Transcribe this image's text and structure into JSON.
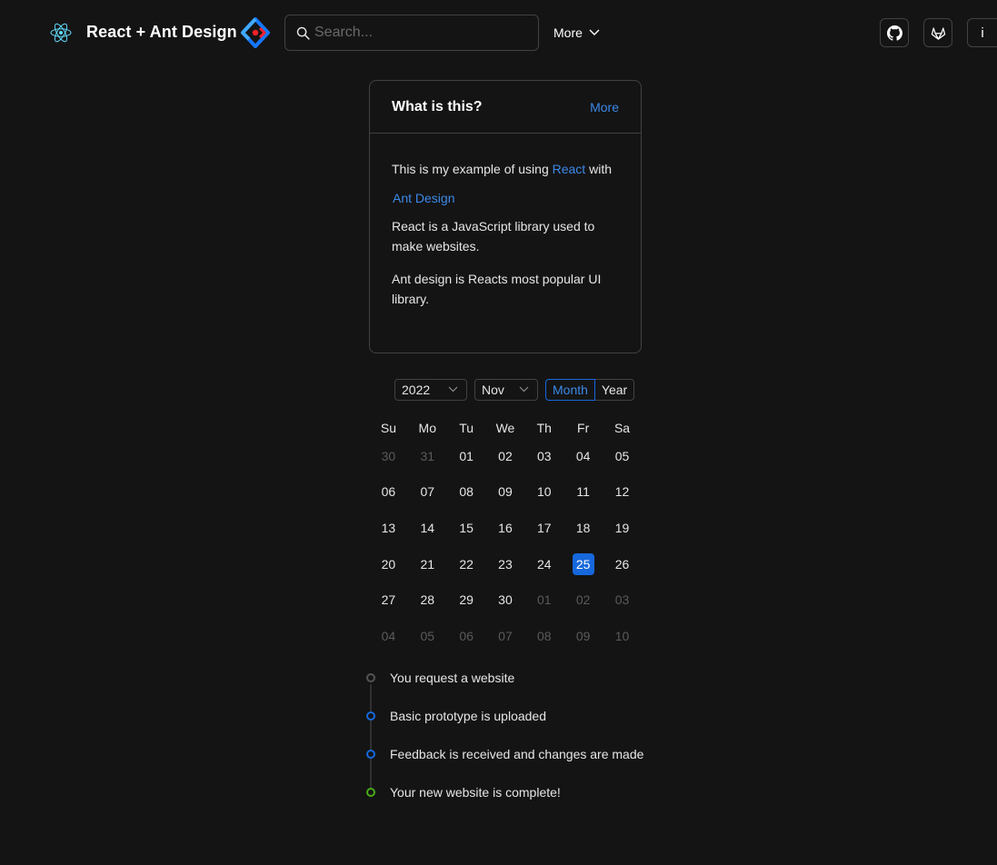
{
  "header": {
    "brand": "React + Ant Design",
    "search_placeholder": "Search...",
    "more_label": "More",
    "icons": [
      "react-logo-icon",
      "ant-design-logo-icon",
      "search-icon",
      "chevron-down-icon",
      "github-icon",
      "gitlab-icon",
      "info-icon"
    ],
    "info_label": "i"
  },
  "card": {
    "title": "What is this?",
    "extra": "More",
    "intro_prefix": "This is my example of using",
    "react_link": "React",
    "intro_middle": "with",
    "antd_link": "Ant Design",
    "paragraph2": "React is a JavaScript library used to make websites.",
    "paragraph3": "Ant design is Reacts most popular UI library."
  },
  "calendar": {
    "year": "2022",
    "month": "Nov",
    "modes": [
      "Month",
      "Year"
    ],
    "active_mode": "Month",
    "weekdays": [
      "Su",
      "Mo",
      "Tu",
      "We",
      "Th",
      "Fr",
      "Sa"
    ],
    "weeks": [
      [
        "30",
        "31",
        "01",
        "02",
        "03",
        "04",
        "05"
      ],
      [
        "06",
        "07",
        "08",
        "09",
        "10",
        "11",
        "12"
      ],
      [
        "13",
        "14",
        "15",
        "16",
        "17",
        "18",
        "19"
      ],
      [
        "20",
        "21",
        "22",
        "23",
        "24",
        "25",
        "26"
      ],
      [
        "27",
        "28",
        "29",
        "30",
        "01",
        "02",
        "03"
      ],
      [
        "04",
        "05",
        "06",
        "07",
        "08",
        "09",
        "10"
      ]
    ],
    "selected_day": "25"
  },
  "timeline": [
    {
      "text": "You request a website",
      "color": "#555555"
    },
    {
      "text": "Basic prototype is uploaded",
      "color": "#1668dc"
    },
    {
      "text": "Feedback is received and changes are made",
      "color": "#1668dc"
    },
    {
      "text": "Your new website is complete!",
      "color": "#49aa19"
    }
  ],
  "colors": {
    "background": "#141414",
    "accent": "#3c89e8",
    "selected": "#1668dc",
    "success": "#49aa19",
    "border": "#424242"
  }
}
